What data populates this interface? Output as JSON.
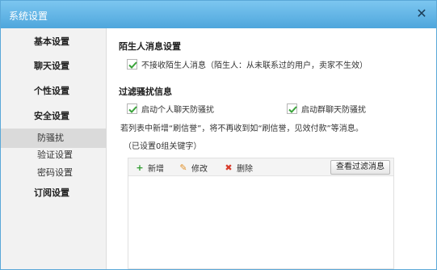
{
  "window": {
    "title": "系统设置",
    "close_glyph": "✕"
  },
  "sidebar": {
    "items": [
      {
        "label": "基本设置"
      },
      {
        "label": "聊天设置"
      },
      {
        "label": "个性设置"
      },
      {
        "label": "安全设置"
      },
      {
        "label": "防骚扰"
      },
      {
        "label": "验证设置"
      },
      {
        "label": "密码设置"
      },
      {
        "label": "订阅设置"
      }
    ],
    "active": "防骚扰"
  },
  "stranger": {
    "title": "陌生人消息设置",
    "option_label": "不接收陌生人消息（陌生人：从未联系过的用户，卖家不生效）",
    "checked": true
  },
  "filter": {
    "title": "过滤骚扰信息",
    "personal_label": "启动个人聊天防骚扰",
    "personal_checked": true,
    "group_label": "启动群聊天防骚扰",
    "group_checked": true,
    "desc": "若列表中新增“刷信誉”，将不再收到如“刷信誉，见效付款”等消息。",
    "count_text": "（已设置0组关键字）"
  },
  "toolbar": {
    "add_label": "新增",
    "add_icon": "plus-icon",
    "edit_label": "修改",
    "edit_icon": "pencil-icon",
    "delete_label": "删除",
    "delete_icon": "x-icon",
    "view_label": "查看过滤消息"
  },
  "colors": {
    "check": "#3aa33a",
    "add": "#2f9c2f",
    "edit": "#e0902a",
    "delete": "#d83a2a",
    "titlebar": "#5aaee0"
  }
}
